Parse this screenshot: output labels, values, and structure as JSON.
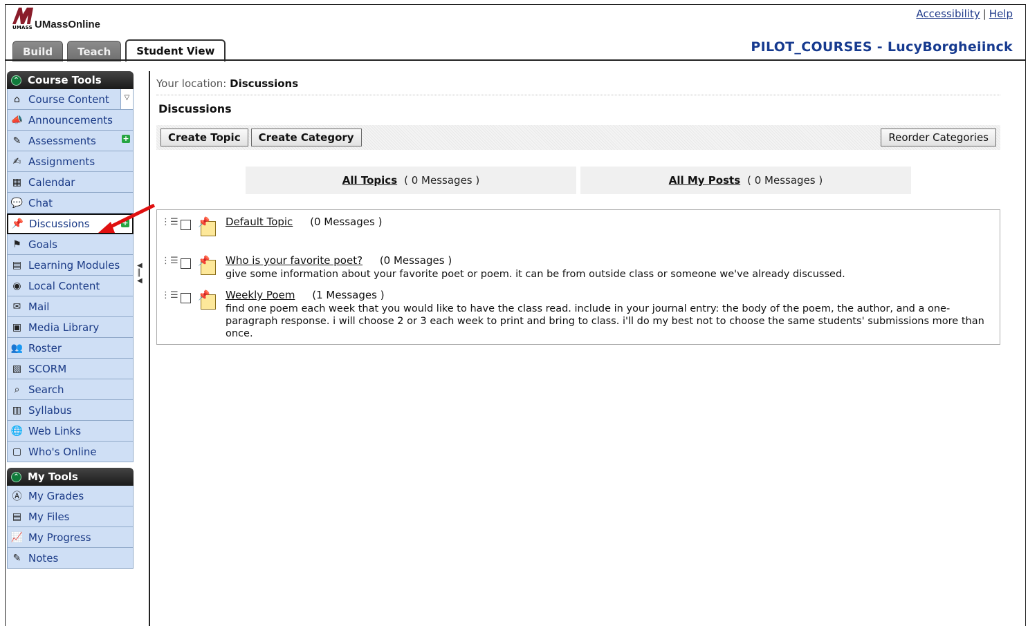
{
  "header": {
    "logo_text": "UMassOnline",
    "logo_small": "UMASS",
    "accessibility_label": "Accessibility",
    "separator": "|",
    "help_label": "Help",
    "course_title": "PILOT_COURSES - LucyBorgheiinck"
  },
  "tabs": [
    {
      "label": "Build"
    },
    {
      "label": "Teach"
    },
    {
      "label": "Student View"
    }
  ],
  "sidebar": {
    "course_tools_title": "Course Tools",
    "course_tools": [
      {
        "label": "Course Content",
        "icon": "home-icon"
      },
      {
        "label": "Announcements",
        "icon": "megaphone-icon"
      },
      {
        "label": "Assessments",
        "icon": "assessment-icon"
      },
      {
        "label": "Assignments",
        "icon": "assignment-icon"
      },
      {
        "label": "Calendar",
        "icon": "calendar-icon"
      },
      {
        "label": "Chat",
        "icon": "chat-icon"
      },
      {
        "label": "Discussions",
        "icon": "pushpin-icon"
      },
      {
        "label": "Goals",
        "icon": "goals-icon"
      },
      {
        "label": "Learning Modules",
        "icon": "module-icon"
      },
      {
        "label": "Local Content",
        "icon": "disc-icon"
      },
      {
        "label": "Mail",
        "icon": "mail-icon"
      },
      {
        "label": "Media Library",
        "icon": "media-icon"
      },
      {
        "label": "Roster",
        "icon": "people-icon"
      },
      {
        "label": "SCORM",
        "icon": "scorm-icon"
      },
      {
        "label": "Search",
        "icon": "magnifier-icon"
      },
      {
        "label": "Syllabus",
        "icon": "syllabus-icon"
      },
      {
        "label": "Web Links",
        "icon": "globe-icon"
      },
      {
        "label": "Who's Online",
        "icon": "online-icon"
      }
    ],
    "my_tools_title": "My Tools",
    "my_tools": [
      {
        "label": "My Grades",
        "icon": "grades-icon"
      },
      {
        "label": "My Files",
        "icon": "files-icon"
      },
      {
        "label": "My Progress",
        "icon": "progress-icon"
      },
      {
        "label": "Notes",
        "icon": "notes-icon"
      }
    ]
  },
  "main": {
    "location_prefix": "Your location:",
    "location": "Discussions",
    "heading": "Discussions",
    "create_topic": "Create Topic",
    "create_category": "Create Category",
    "reorder_categories": "Reorder Categories",
    "all_topics": "All Topics",
    "all_topics_count": "( 0 Messages )",
    "all_my_posts": "All My Posts",
    "all_my_posts_count": "( 0 Messages )",
    "topics": [
      {
        "title": "Default Topic",
        "count": "(0 Messages )",
        "description": ""
      },
      {
        "title": "Who is your favorite poet?",
        "count": "(0 Messages )",
        "description": "give some information about your favorite poet or poem. it can be from outside class or someone we've already discussed."
      },
      {
        "title": "Weekly Poem",
        "count": "(1 Messages )",
        "description": "find one poem each week that you would like to have the class read. include in your journal entry: the body of the poem, the author, and a one-paragraph response. i will choose 2 or 3 each week to print and bring to class. i'll do my best not to choose the same students' submissions more than once."
      }
    ]
  },
  "colors": {
    "accent": "#163a8f",
    "sidebar_bg": "#cfdff5",
    "annotation_arrow": "#e01010"
  }
}
